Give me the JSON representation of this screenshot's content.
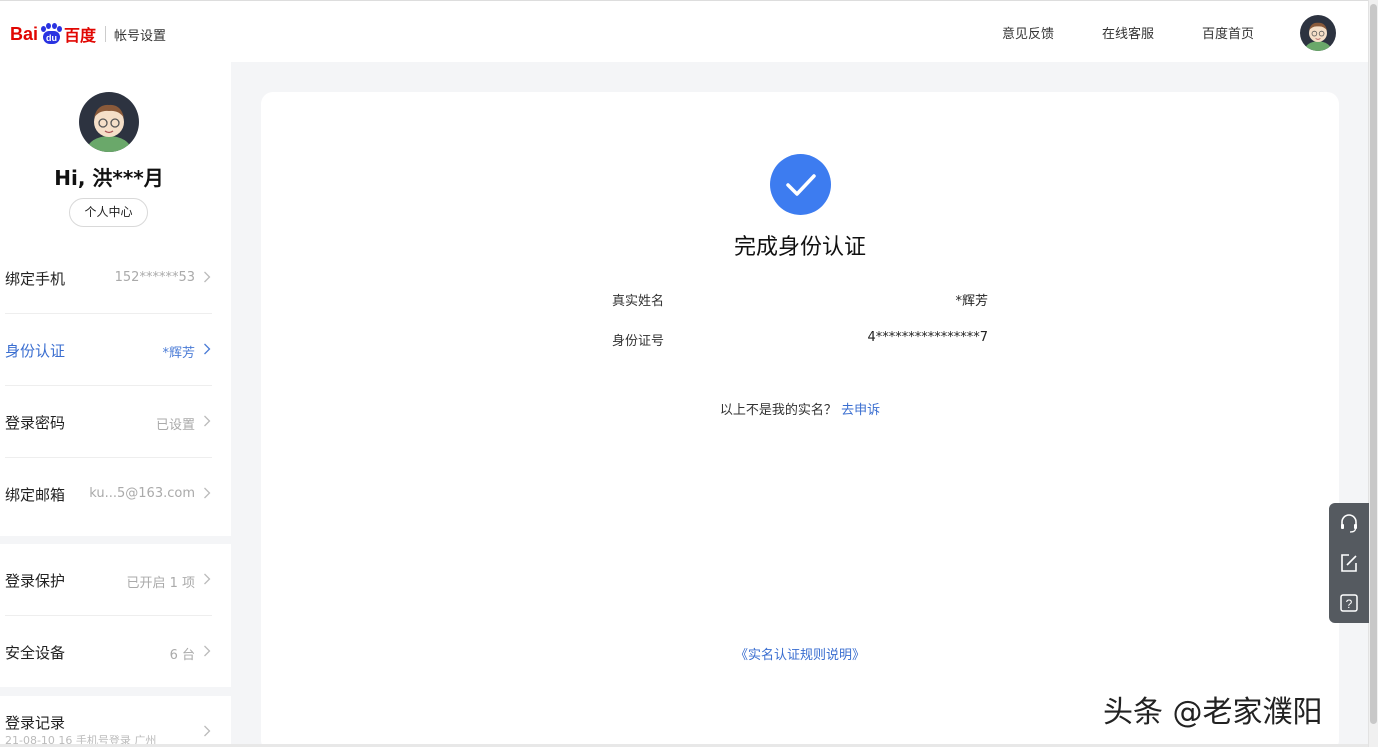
{
  "header": {
    "logo_bai": "Bai",
    "logo_du": "du",
    "logo_cn": "百度",
    "subtitle": "帐号设置",
    "nav": [
      "意见反馈",
      "在线客服",
      "百度首页"
    ],
    "avatar_icon": "user-avatar"
  },
  "sidebar": {
    "greeting": "Hi, 洪***月",
    "center_button": "个人中心",
    "items": [
      {
        "label": "绑定手机",
        "value": "152******53"
      },
      {
        "label": "身份认证",
        "value": "*辉芳",
        "active": true
      },
      {
        "label": "登录密码",
        "value": "已设置"
      },
      {
        "label": "绑定邮箱",
        "value": "ku...5@163.com"
      },
      {
        "label": "登录保护",
        "value": "已开启 1 项"
      },
      {
        "label": "安全设备",
        "value": "6 台"
      },
      {
        "label": "登录记录",
        "value": "",
        "sub": "21-08-10 16 手机号登录 广州"
      }
    ]
  },
  "main": {
    "status_icon": "check-icon",
    "title": "完成身份认证",
    "fields": [
      {
        "label": "真实姓名",
        "value": "*辉芳"
      },
      {
        "label": "身份证号",
        "value": "4****************7"
      }
    ],
    "not_me_text": "以上不是我的实名？",
    "appeal_link": "去申诉",
    "rules_link": "《实名认证规则说明》"
  },
  "float_toolbar": {
    "icons": [
      "headset-icon",
      "edit-icon",
      "help-icon"
    ],
    "help_glyph": "?"
  },
  "watermark": "头条 @老家濮阳",
  "colors": {
    "accent": "#3d7cf0",
    "link": "#3a6ed0",
    "brand_red": "#e10602",
    "brand_blue": "#2932e1"
  }
}
